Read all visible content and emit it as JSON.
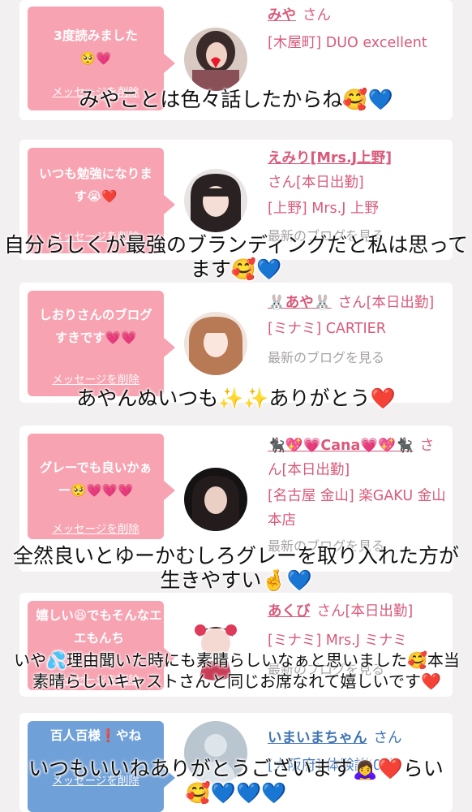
{
  "colors": {
    "pink_bubble": "#f7a3b1",
    "blue_bubble": "#6fa0d8",
    "pink_text": "#d95a7a",
    "blue_text": "#3f74b8"
  },
  "cards": [
    {
      "message": "3度読みました🥺💗",
      "delete_label": "メッセージを削除",
      "avatar_icon": "cast-avatar-icon",
      "name": "みや",
      "san": "さん",
      "shop": "[木屋町] DUO excellent",
      "latest": "最新のブログを見る",
      "caption": "みやことは色々話したからね🥰💙"
    },
    {
      "message": "いつも勉強になります😭❤️",
      "delete_label": "メッセージを削除",
      "avatar_icon": "cast-avatar-icon",
      "name": "えみり[Mrs.J上野]",
      "san": "さん[本日出勤]",
      "shop": "[上野] Mrs.J 上野",
      "latest": "最新のブログを見る",
      "caption": "自分らしくが最強のブランディングだと私は思ってます🥰💙"
    },
    {
      "message": "しおりさんのブログすきです💗💗",
      "delete_label": "メッセージを削除",
      "avatar_icon": "cast-avatar-icon",
      "name": "🐰あや🐰",
      "san": "さん[本日出勤]",
      "shop": "[ミナミ] CARTIER",
      "latest": "最新のブログを見る",
      "caption": "あやんぬいつも✨✨ありがとう❤️"
    },
    {
      "message": "グレーでも良いかぁー🥺💗💗💗",
      "delete_label": "メッセージを削除",
      "avatar_icon": "cast-avatar-icon",
      "name": "🐈‍⬛💖💗Cana💗💖🐈‍⬛",
      "san": "さん[本日出勤]",
      "shop": "[名古屋 金山] 楽GAKU 金山本店",
      "latest": "最新のブログを見る",
      "caption": "全然良いとゆーかむしろグレーを取り入れた方が生きやすい🤞💙"
    },
    {
      "message": "嬉しい😆でもそんなエエもんち",
      "delete_label": "メッセージを削除",
      "avatar_icon": "cast-avatar-icon",
      "name": "あくび",
      "san": "さん[本日出勤]",
      "shop": "[ミナミ] Mrs.J ミナミ",
      "latest": "最新のブログを見る",
      "caption": "いや💦理由聞いた時にも素晴らしいなぁと思いました🥰本当素晴らしいキャストさんと同じお席なれて嬉しいです❤️"
    },
    {
      "message": "百人百様❗️やね",
      "delete_label": "メッセージを削除",
      "avatar_icon": "default-avatar-icon",
      "name": "いまいまちゃん",
      "san": "さん",
      "shop": "[大阪府] 体験談 0件",
      "latest": "",
      "caption": "いつもいいねありがとうございます🙇‍♀️❤️らい🥰💙💙💙"
    }
  ]
}
